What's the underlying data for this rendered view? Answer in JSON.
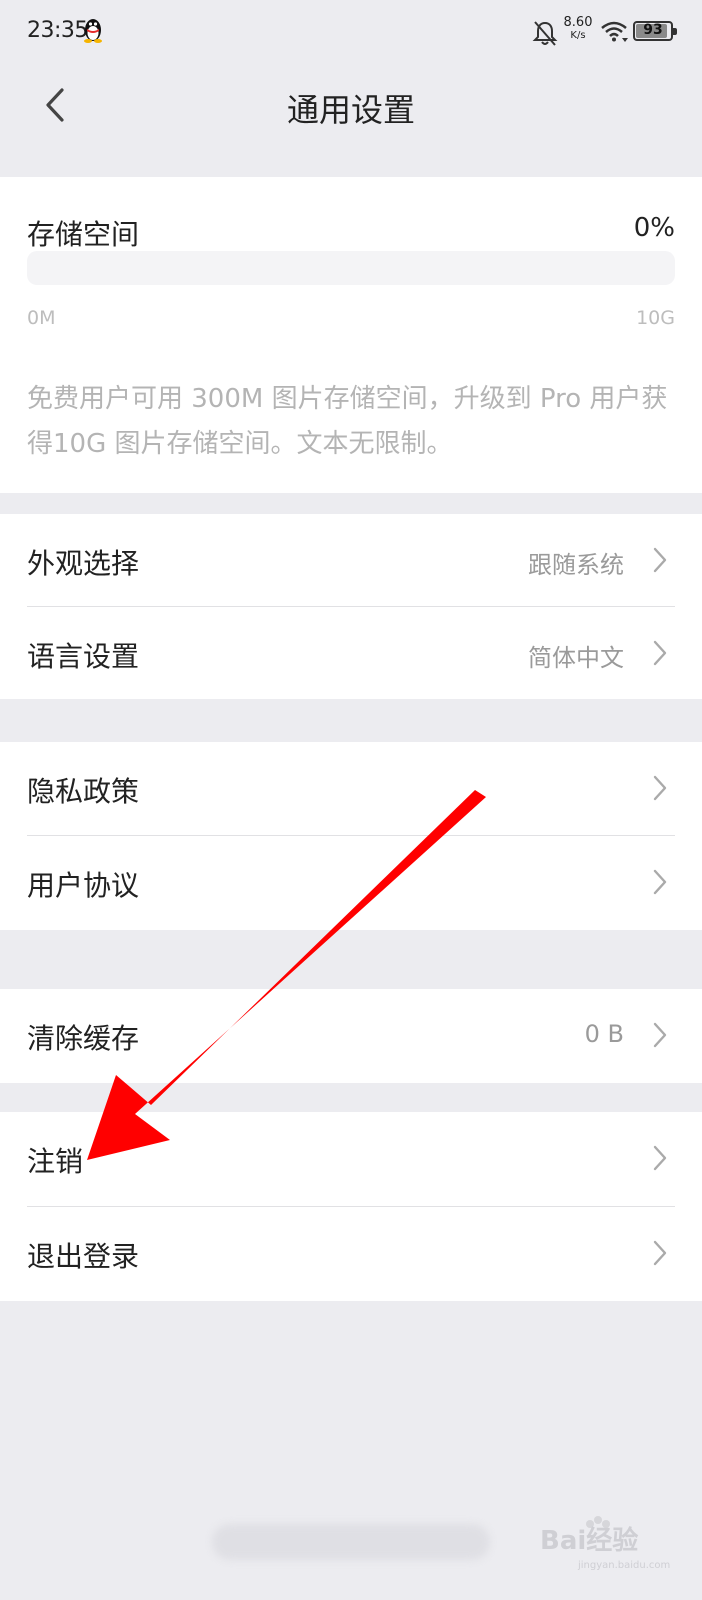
{
  "status_bar": {
    "time": "23:35",
    "net_speed_value": "8.60",
    "net_speed_unit": "K/s",
    "battery_level": "93"
  },
  "header": {
    "title": "通用设置"
  },
  "storage": {
    "title": "存储空间",
    "percent": "0%",
    "usage_fraction": 0,
    "min_label": "0M",
    "max_label": "10G",
    "note": "免费用户可用 300M 图片存储空间，升级到 Pro 用户获得10G 图片存储空间。文本无限制。"
  },
  "groups": {
    "appearance": {
      "label": "外观选择",
      "value": "跟随系统"
    },
    "language": {
      "label": "语言设置",
      "value": "简体中文"
    },
    "privacy": {
      "label": "隐私政策"
    },
    "agreement": {
      "label": "用户协议"
    },
    "cache": {
      "label": "清除缓存",
      "value": "0 B"
    },
    "deactivate": {
      "label": "注销"
    },
    "logout": {
      "label": "退出登录"
    }
  },
  "watermark": {
    "text": "Bai经验",
    "sub": "jingyan.baidu.com"
  },
  "colors": {
    "background": "#ececf0",
    "card": "#ffffff",
    "arrow": "#ff0000",
    "secondary_text": "#9a9a9a"
  }
}
